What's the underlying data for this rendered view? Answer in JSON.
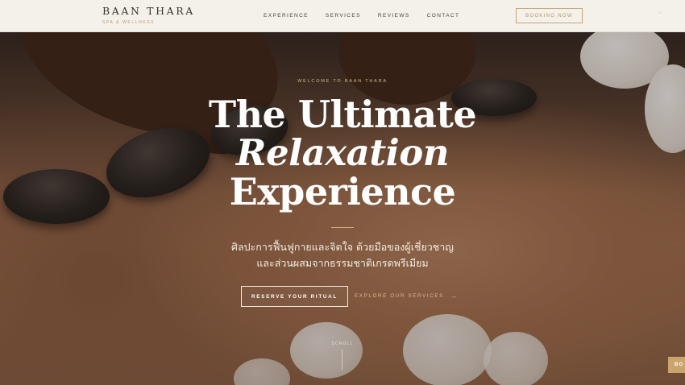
{
  "brand": {
    "name": "BAAN THARA",
    "tagline": "SPA & WELLNESS"
  },
  "nav": {
    "items": [
      "EXPERIENCE",
      "SERVICES",
      "REVIEWS",
      "CONTACT"
    ]
  },
  "header": {
    "booking_label": "BOOKING NOW"
  },
  "hero": {
    "eyebrow": "WELCOME TO BAAN THARA",
    "headline_line1": "The Ultimate",
    "headline_line2": "Relaxation",
    "headline_line3": "Experience",
    "subtitle_line1": "ศิลปะการฟื้นฟูกายและจิตใจ ด้วยมือของผู้เชี่ยวชาญ",
    "subtitle_line2": "และส่วนผสมจากธรรมชาติเกรดพรีเมียม",
    "primary_cta": "RESERVE YOUR RITUAL",
    "secondary_cta": "EXPLORE OUR SERVICES",
    "secondary_icon": "arrow-right-icon",
    "scroll_label": "SCROLL"
  },
  "floating": {
    "label": "BO"
  },
  "colors": {
    "accent_gold": "#c8a67a",
    "header_bg": "#f4f1ea",
    "text_dark": "#3a3530"
  }
}
